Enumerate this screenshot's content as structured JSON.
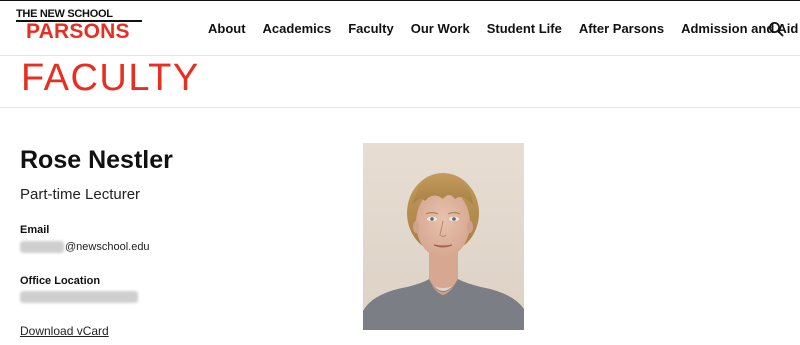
{
  "header": {
    "logo_top": "THE NEW SCHOOL",
    "logo_main": "PARSONS",
    "nav": [
      "About",
      "Academics",
      "Faculty",
      "Our Work",
      "Student Life",
      "After Parsons",
      "Admission and Aid"
    ],
    "search_icon": "search-icon"
  },
  "section": {
    "title": "FACULTY"
  },
  "profile": {
    "name": "Rose Nestler",
    "role": "Part-time Lecturer",
    "email_label": "Email",
    "email_domain": "@newschool.edu",
    "office_label": "Office Location",
    "vcard_label": "Download vCard"
  },
  "colors": {
    "brand_red": "#e82e21",
    "text": "#111111",
    "divider": "#e4e4e4"
  }
}
